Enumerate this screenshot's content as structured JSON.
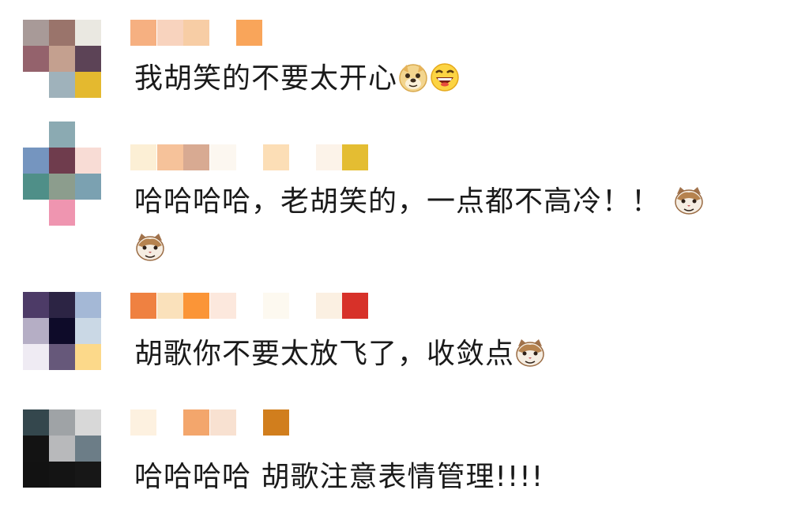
{
  "comments": [
    {
      "text": "我胡笑的不要太开心",
      "emojis": [
        "doge-emoji",
        "laugh-emoji"
      ],
      "avatar_colors": [
        "#a89a98",
        "#9a746b",
        "#eae8e1",
        "#94626c",
        "#c4a08f",
        "#5c4356",
        "#ffffff",
        "#9fb2bb",
        "#e4b92f"
      ],
      "name_colors": [
        "#f6b081",
        "#f8d3be",
        "#f7cda5",
        "#ffffff",
        "#f9a55a"
      ]
    },
    {
      "text": "哈哈哈哈，老胡笑的，一点都不高冷！！",
      "emojis": [
        "cat-emoji",
        "cat-emoji"
      ],
      "avatar_colors": [
        "#ffffff",
        "#8baab2",
        "#ffffff",
        "#7595bf",
        "#6f3c4d",
        "#f8dcd5",
        "#4f8f88",
        "#8c9d8d",
        "#7ba1b1",
        "#ffffff",
        "#ef95b0",
        "#ffffff"
      ],
      "name_colors": [
        "#fcefd5",
        "#f6c29a",
        "#d8aa92",
        "#fcf7f0",
        "#ffffff",
        "#fcdeb6",
        "#ffffff",
        "#fcf3e9",
        "#e4bd32"
      ]
    },
    {
      "text": "胡歌你不要太放飞了，收敛点",
      "emojis": [
        "cat-emoji"
      ],
      "avatar_colors": [
        "#4d3b67",
        "#2c2444",
        "#a4b8d6",
        "#b5aec5",
        "#0e0b29",
        "#cad8e5",
        "#efebf3",
        "#66587a",
        "#fcd98a"
      ],
      "name_colors": [
        "#ef8141",
        "#fae1bb",
        "#fb9537",
        "#fce8dd",
        "#ffffff",
        "#fdf9f0",
        "#ffffff",
        "#fbf0e2",
        "#d73129"
      ]
    },
    {
      "text": "哈哈哈哈 胡歌注意表情管理!!!!",
      "emojis": [],
      "avatar_colors": [
        "#34474d",
        "#9fa3a6",
        "#d8d8d8",
        "#131313",
        "#b8b9bb",
        "#6c7d87",
        "#121212",
        "#141414",
        "#171717"
      ],
      "name_colors": [
        "#fdf1e0",
        "#ffffff",
        "#f3a66c",
        "#f8e1d1",
        "#ffffff",
        "#d17e1d"
      ]
    }
  ]
}
